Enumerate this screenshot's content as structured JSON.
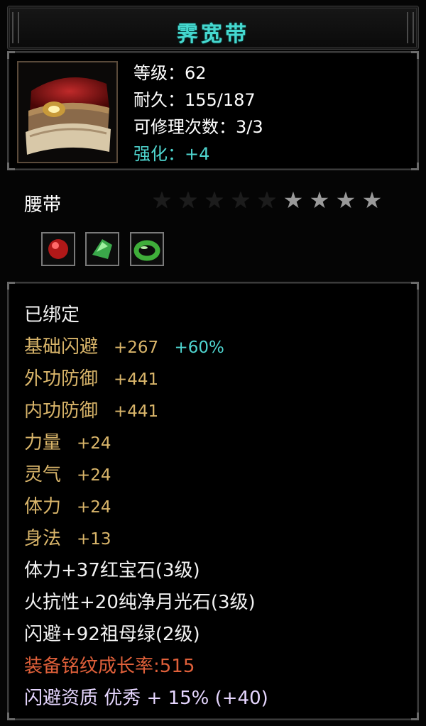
{
  "item": {
    "name": "霁宽带",
    "type": "腰带",
    "level_line": "等级：62",
    "durability_line": "耐久：155/187",
    "repair_line": "可修理次数：3/3",
    "enhance_line": "强化：+4",
    "stars": {
      "total": 9,
      "lit": 4
    },
    "gems": [
      "ruby-gem-icon",
      "emerald-gem-icon",
      "jade-ring-gem-icon"
    ],
    "bound": "已绑定",
    "attributes": [
      {
        "label": "基础闪避",
        "value": "+267",
        "bonus": "+60%"
      },
      {
        "label": "外功防御",
        "value": "+441"
      },
      {
        "label": "内功防御",
        "value": "+441"
      },
      {
        "label": "力量",
        "value": "+24"
      },
      {
        "label": "灵气",
        "value": "+24"
      },
      {
        "label": "体力",
        "value": "+24"
      },
      {
        "label": "身法",
        "value": "+13"
      }
    ],
    "gem_lines": [
      "体力+37红宝石(3级)",
      "火抗性+20纯净月光石(3级)",
      "闪避+92祖母绿(2级)"
    ],
    "growth_line": "装备铭纹成长率:515",
    "quality_line": "闪避资质 优秀 + 15% (+40)"
  },
  "colors": {
    "title": "#45d8cf",
    "stat_text": "#ffffff",
    "enhance": "#4fd6d0",
    "attribute": "#d9b56a",
    "growth": "#e0603a",
    "quality": "#e6d6ff"
  }
}
